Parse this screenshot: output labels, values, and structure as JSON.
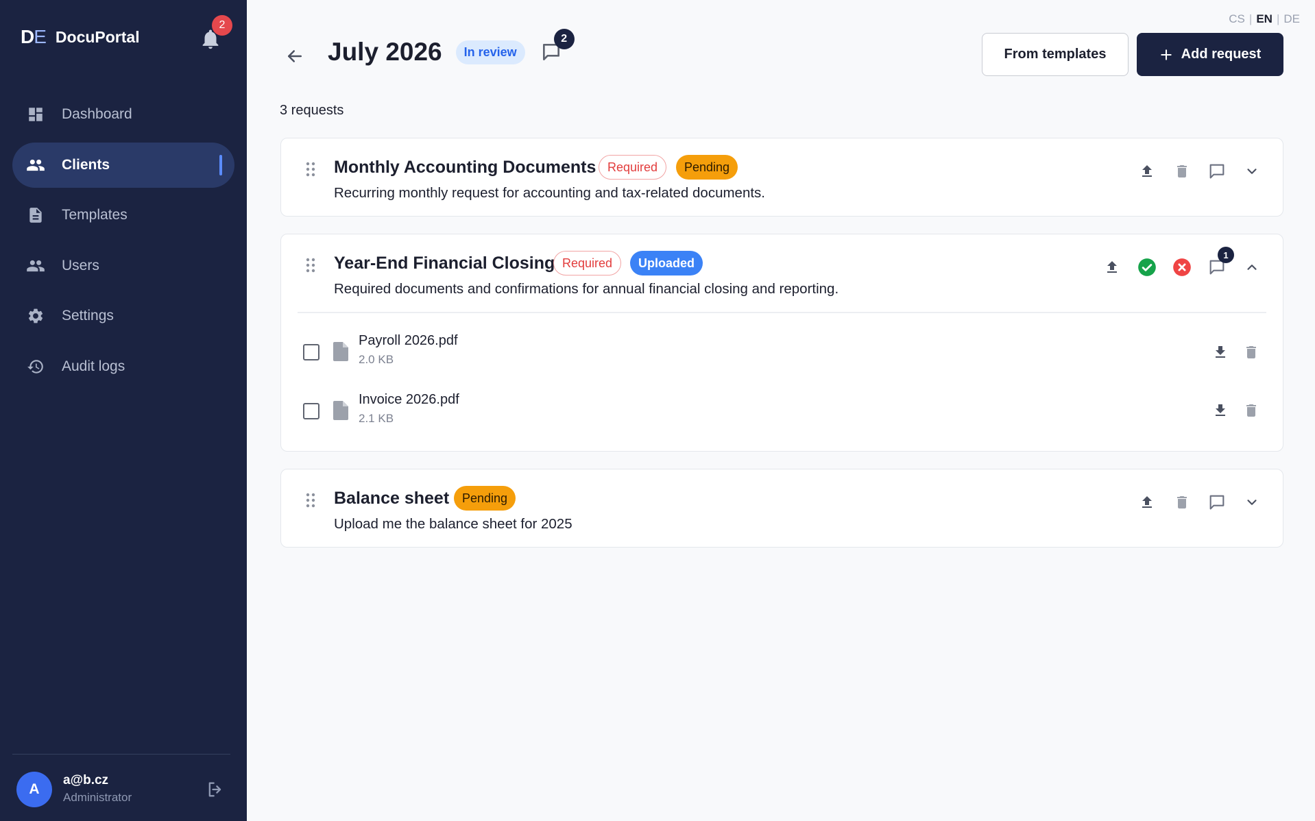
{
  "brand": {
    "logo_d": "D",
    "logo_e": "E",
    "name": "DocuPortal"
  },
  "notifications": {
    "count": "2"
  },
  "nav": {
    "items": [
      {
        "label": "Dashboard",
        "icon": "dashboard-icon",
        "active": false
      },
      {
        "label": "Clients",
        "icon": "clients-icon",
        "active": true
      },
      {
        "label": "Templates",
        "icon": "document-icon",
        "active": false
      },
      {
        "label": "Users",
        "icon": "users-icon",
        "active": false
      },
      {
        "label": "Settings",
        "icon": "gear-icon",
        "active": false
      },
      {
        "label": "Audit logs",
        "icon": "history-icon",
        "active": false
      }
    ]
  },
  "user": {
    "initial": "A",
    "email": "a@b.cz",
    "role": "Administrator"
  },
  "languages": {
    "cs": "CS",
    "en": "EN",
    "de": "DE",
    "sep": "|",
    "active": "EN"
  },
  "header": {
    "title": "July 2026",
    "status": "In review",
    "comments_count": "2",
    "from_templates_label": "From templates",
    "add_request_label": "Add request"
  },
  "requests_count": "3 requests",
  "requests": [
    {
      "title": "Monthly Accounting Documents",
      "tags": [
        "Required",
        "Pending"
      ],
      "description": "Recurring monthly request for accounting and tax-related documents."
    },
    {
      "title": "Year-End Financial Closing",
      "tags": [
        "Required",
        "Uploaded"
      ],
      "description": "Required documents and confirmations for annual financial closing and reporting.",
      "comments_count": "1",
      "files": [
        {
          "name": "Payroll 2026.pdf",
          "size": "2.0 KB"
        },
        {
          "name": "Invoice 2026.pdf",
          "size": "2.1 KB"
        }
      ]
    },
    {
      "title": "Balance sheet",
      "tags": [
        "Pending"
      ],
      "description": "Upload me the balance sheet for 2025"
    }
  ],
  "colors": {
    "sidebar_bg": "#1b2341",
    "accent": "#3b82f6",
    "pending": "#f59e0b",
    "required": "#e23c3c",
    "approve": "#16a34a",
    "reject": "#ef4444"
  }
}
